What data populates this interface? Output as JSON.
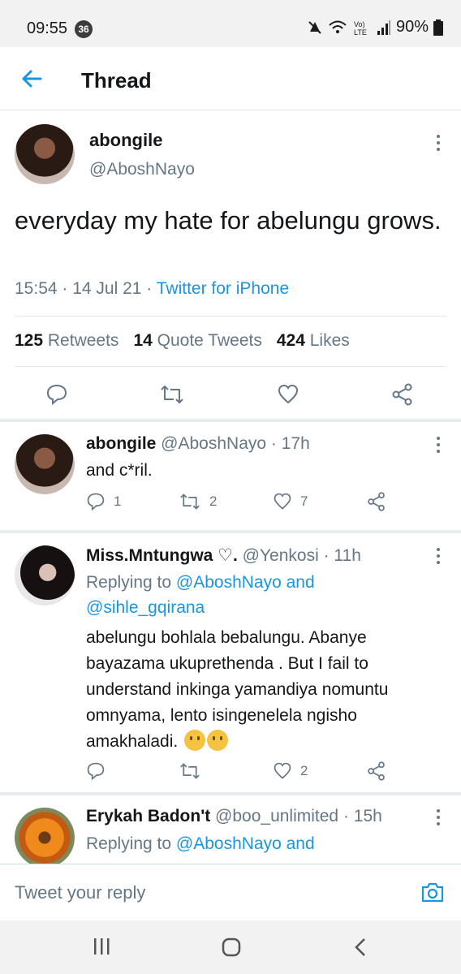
{
  "status_bar": {
    "time": "09:55",
    "badge": "36",
    "battery": "90%"
  },
  "header": {
    "title": "Thread"
  },
  "main_tweet": {
    "name": "abongile",
    "handle": "@AboshNayo",
    "text": "everyday my hate for abelungu grows.",
    "time": "15:54 · 14 Jul 21 · ",
    "source": "Twitter for iPhone",
    "retweets_count": "125",
    "retweets_label": "Retweets",
    "quotes_count": "14",
    "quotes_label": "Quote Tweets",
    "likes_count": "424",
    "likes_label": "Likes"
  },
  "replies": [
    {
      "name": "abongile",
      "meta": " @AboshNayo · 17h",
      "text": "and c*ril.",
      "reply_count": "1",
      "retweet_count": "2",
      "like_count": "7"
    },
    {
      "name": "Miss.Mntungwa ♡.",
      "meta": " @Yenkosi · 11h",
      "replying_prefix": "Replying to ",
      "replying_to_1": "@AboshNayo and",
      "replying_to_2": "@sihle_gqirana",
      "text": "abelungu bohlala bebalungu. Abanye bayazama ukuprethenda . But I fail to understand inkinga yamandiya nomuntu omnyama, lento isingenelela ngisho amakhaladi.",
      "like_count": "2"
    },
    {
      "name": "Erykah Badon't",
      "meta": " @boo_unlimited · 15h",
      "replying_prefix": "Replying to ",
      "replying_to_1": "@AboshNayo and"
    }
  ],
  "composer": {
    "placeholder": "Tweet your reply"
  },
  "colors": {
    "accent": "#1b95e0",
    "secondary_text": "#657786",
    "primary_text": "#14171a",
    "divider": "#e1e8ed"
  },
  "icons": [
    "back-arrow-icon",
    "more-vertical-icon",
    "reply-icon",
    "retweet-icon",
    "like-icon",
    "share-icon",
    "camera-icon",
    "mute-icon",
    "wifi-icon",
    "signal-icon",
    "battery-icon",
    "recents-icon",
    "home-icon",
    "back-nav-icon"
  ]
}
